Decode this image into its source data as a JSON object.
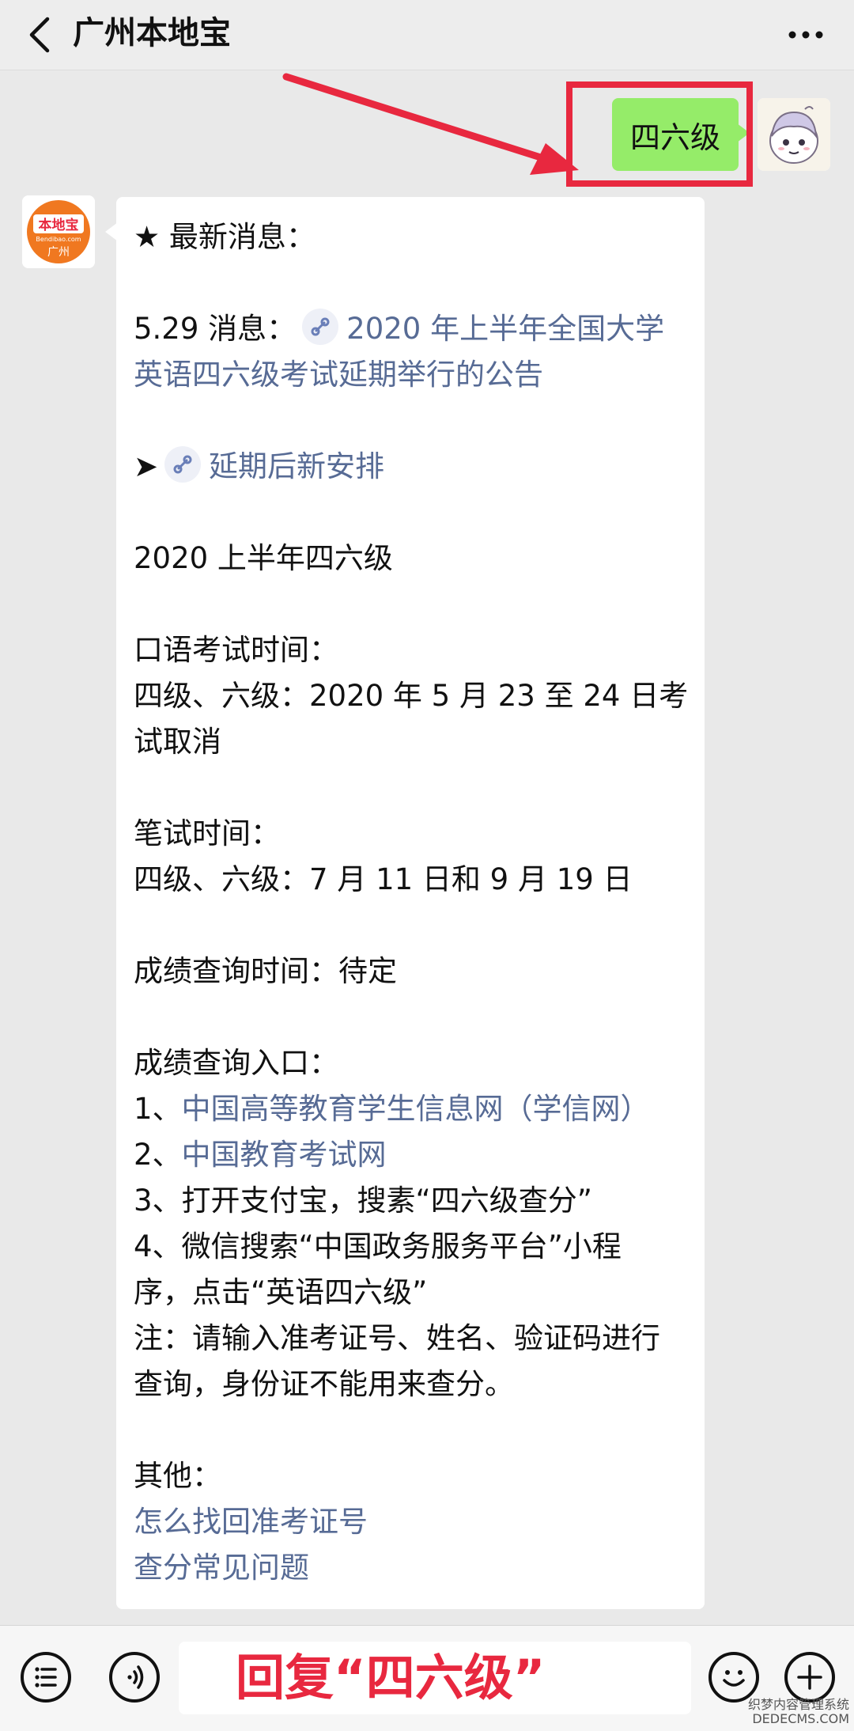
{
  "header": {
    "title": "广州本地宝"
  },
  "user_message": {
    "text": "四六级"
  },
  "bot_avatar": {
    "logo_text": "本地宝",
    "logo_sub": "Bendibao.com",
    "logo_city": "广州"
  },
  "bot_message": {
    "heading": "★ 最新消息：",
    "news_prefix": "5.29 消息：",
    "news_link_line1": "2020 年上半年全国大学",
    "news_link_line2": "英语四六级考试延期举行的公告",
    "arrow": "➤",
    "schedule_link": "延期后新安排",
    "section_title": "2020 上半年四六级",
    "oral_label": "口语考试时间：",
    "oral_line1": "四级、六级：2020 年 5 月 23 至 24 日考",
    "oral_line2": "试取消",
    "written_label": "笔试时间：",
    "written_line": "四级、六级：7 月 11 日和 9 月 19 日",
    "score_time": "成绩查询时间：待定",
    "entry_label": "成绩查询入口：",
    "entry1_prefix": "1、",
    "entry1_link": "中国高等教育学生信息网（学信网）",
    "entry2_prefix": "2、",
    "entry2_link": "中国教育考试网",
    "entry3": "3、打开支付宝，搜素“四六级查分”",
    "entry4_line1": "4、微信搜索“中国政务服务平台”小程",
    "entry4_line2": "序，点击“英语四六级”",
    "note_line1": "注：请输入准考证号、姓名、验证码进行",
    "note_line2": "查询，身份证不能用来查分。",
    "other_label": "其他：",
    "other_link1": "怎么找回准考证号",
    "other_link2": "查分常见问题"
  },
  "input_bar": {
    "overlay_text": "回复“四六级”"
  },
  "watermark": {
    "line1": "织梦内容管理系统",
    "line2": "DEDECMS.COM"
  },
  "colors": {
    "link": "#576b95",
    "bubble_green": "#95ec69",
    "highlight_red": "#e8283f",
    "logo_orange": "#f07820"
  }
}
